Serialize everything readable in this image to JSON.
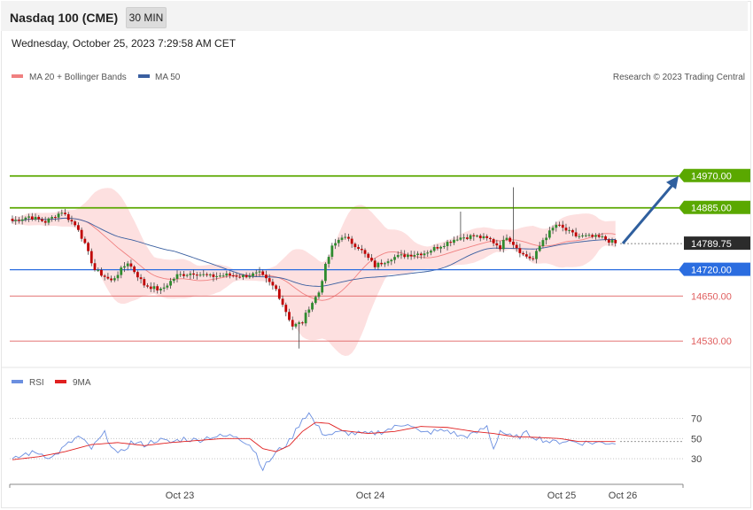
{
  "header": {
    "title": "Nasdaq 100 (CME)",
    "timeframe": "30 MIN",
    "datetime": "Wednesday, October 25, 2023 7:29:58 AM CET"
  },
  "colors": {
    "bull": "#2e8b2e",
    "bear": "#c00000",
    "band_fill": "#fde0e0",
    "ma20": "#f08080",
    "ma50": "#3a5fa0",
    "resistance": "#5aa800",
    "pivot": "#2b6de0",
    "support": "#e06060",
    "arrow": "#2f5f9e",
    "rsi": "#6b8fe0",
    "rsi_ma": "#e02020"
  },
  "chart_data": [
    {
      "type": "candlestick",
      "legend": [
        {
          "name": "MA 20 + Bollinger Bands",
          "color": "#f08080"
        },
        {
          "name": "MA 50",
          "color": "#3a5fa0"
        }
      ],
      "credit": "Research © 2023 Trading Central",
      "ylim": [
        14495,
        15085
      ],
      "x_labels": [
        "Oct 23",
        "Oct 24",
        "Oct 25",
        "Oct 26"
      ],
      "levels": [
        {
          "value": 14970.0,
          "label": "14970.00",
          "kind": "resistance"
        },
        {
          "value": 14885.0,
          "label": "14885.00",
          "kind": "resistance"
        },
        {
          "value": 14789.75,
          "label": "14789.75",
          "kind": "last"
        },
        {
          "value": 14720.0,
          "label": "14720.00",
          "kind": "pivot"
        },
        {
          "value": 14650.0,
          "label": "14650.00",
          "kind": "support"
        },
        {
          "value": 14530.0,
          "label": "14530.00",
          "kind": "support"
        }
      ],
      "forecast": {
        "from": 14790,
        "to": 14970
      },
      "path_points": [
        [
          0,
          14850
        ],
        [
          5,
          14862
        ],
        [
          10,
          14848
        ],
        [
          15,
          14875
        ],
        [
          20,
          14830
        ],
        [
          25,
          14720
        ],
        [
          30,
          14690
        ],
        [
          35,
          14740
        ],
        [
          40,
          14680
        ],
        [
          45,
          14665
        ],
        [
          50,
          14705
        ],
        [
          55,
          14712
        ],
        [
          60,
          14702
        ],
        [
          65,
          14706
        ],
        [
          70,
          14703
        ],
        [
          75,
          14710
        ],
        [
          80,
          14668
        ],
        [
          85,
          14570
        ],
        [
          88,
          14580
        ],
        [
          90,
          14620
        ],
        [
          93,
          14660
        ],
        [
          95,
          14730
        ],
        [
          97,
          14780
        ],
        [
          100,
          14810
        ],
        [
          105,
          14780
        ],
        [
          110,
          14730
        ],
        [
          115,
          14752
        ],
        [
          120,
          14760
        ],
        [
          125,
          14765
        ],
        [
          130,
          14785
        ],
        [
          135,
          14805
        ],
        [
          140,
          14810
        ],
        [
          145,
          14800
        ],
        [
          148,
          14780
        ],
        [
          150,
          14810
        ],
        [
          155,
          14760
        ],
        [
          158,
          14748
        ],
        [
          161,
          14800
        ],
        [
          165,
          14840
        ],
        [
          168,
          14825
        ],
        [
          171,
          14810
        ],
        [
          175,
          14808
        ],
        [
          179,
          14805
        ],
        [
          183,
          14790
        ]
      ],
      "wick_spikes": [
        {
          "index": 87,
          "low": 14510
        },
        {
          "index": 152,
          "high": 14940
        },
        {
          "index": 136,
          "high": 14875
        }
      ]
    },
    {
      "type": "line",
      "legend": [
        {
          "name": "RSI",
          "color": "#6b8fe0"
        },
        {
          "name": "9MA",
          "color": "#e02020"
        }
      ],
      "ylim": [
        9,
        88
      ],
      "gridlines": [
        70,
        50,
        30
      ],
      "tick_labels": [
        "70",
        "50",
        "30"
      ],
      "rsi_points": [
        [
          0,
          28
        ],
        [
          4,
          35
        ],
        [
          8,
          36
        ],
        [
          12,
          31
        ],
        [
          16,
          42
        ],
        [
          20,
          52
        ],
        [
          24,
          40
        ],
        [
          28,
          55
        ],
        [
          32,
          33
        ],
        [
          36,
          46
        ],
        [
          40,
          44
        ],
        [
          44,
          49
        ],
        [
          48,
          46
        ],
        [
          52,
          50
        ],
        [
          56,
          48
        ],
        [
          60,
          52
        ],
        [
          64,
          52
        ],
        [
          68,
          53
        ],
        [
          72,
          44
        ],
        [
          74,
          35
        ],
        [
          76,
          20
        ],
        [
          80,
          36
        ],
        [
          84,
          47
        ],
        [
          86,
          58
        ],
        [
          88,
          70
        ],
        [
          90,
          75
        ],
        [
          92,
          64
        ],
        [
          94,
          56
        ],
        [
          96,
          54
        ],
        [
          100,
          56
        ],
        [
          104,
          55
        ],
        [
          108,
          54
        ],
        [
          112,
          57
        ],
        [
          116,
          61
        ],
        [
          120,
          66
        ],
        [
          124,
          55
        ],
        [
          128,
          57
        ],
        [
          132,
          58
        ],
        [
          136,
          52
        ],
        [
          140,
          54
        ],
        [
          144,
          62
        ],
        [
          146,
          40
        ],
        [
          148,
          58
        ],
        [
          152,
          50
        ],
        [
          156,
          55
        ],
        [
          160,
          50
        ],
        [
          164,
          46
        ],
        [
          168,
          48
        ],
        [
          172,
          46
        ]
      ],
      "ma_points": [
        [
          0,
          29
        ],
        [
          8,
          32
        ],
        [
          16,
          37
        ],
        [
          24,
          44
        ],
        [
          32,
          46
        ],
        [
          40,
          43
        ],
        [
          48,
          46
        ],
        [
          56,
          48
        ],
        [
          64,
          50
        ],
        [
          72,
          50
        ],
        [
          76,
          40
        ],
        [
          80,
          37
        ],
        [
          84,
          43
        ],
        [
          88,
          57
        ],
        [
          92,
          66
        ],
        [
          96,
          65
        ],
        [
          100,
          58
        ],
        [
          108,
          55
        ],
        [
          116,
          57
        ],
        [
          124,
          62
        ],
        [
          132,
          61
        ],
        [
          140,
          57
        ],
        [
          146,
          55
        ],
        [
          152,
          52
        ],
        [
          160,
          51
        ],
        [
          166,
          50
        ],
        [
          172,
          47
        ]
      ]
    }
  ]
}
